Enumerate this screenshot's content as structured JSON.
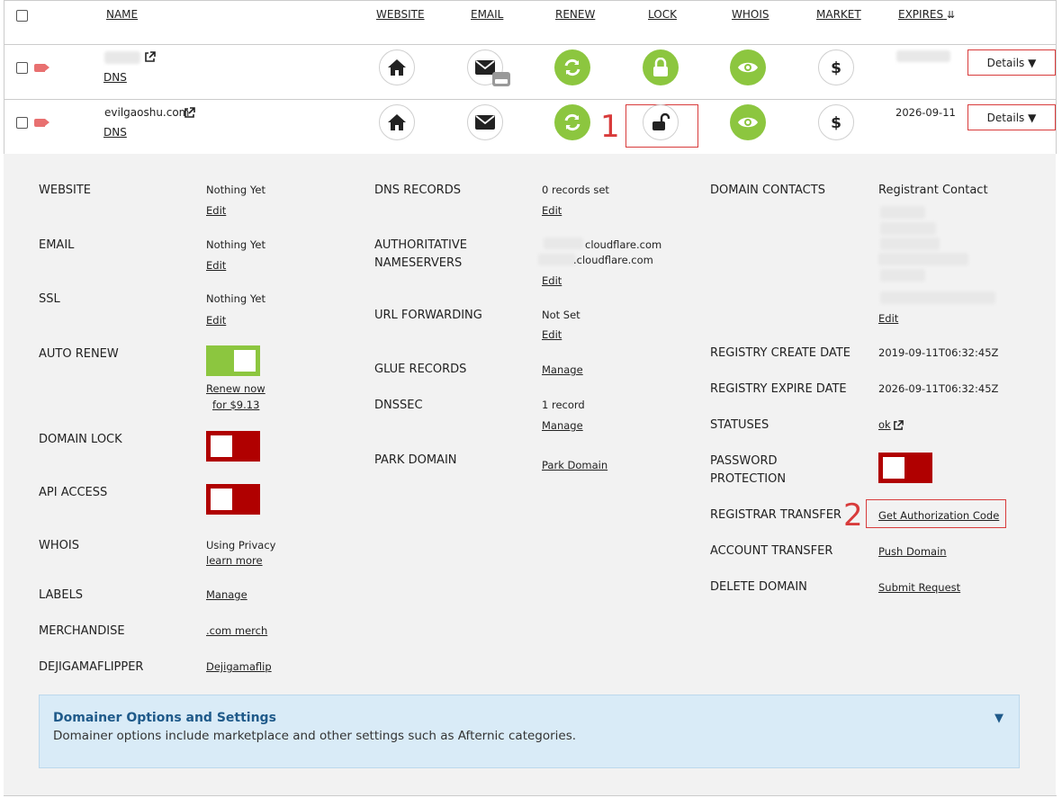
{
  "columns": {
    "name": "NAME",
    "website": "WEBSITE",
    "email": "EMAIL",
    "renew": "RENEW",
    "lock": "LOCK",
    "whois": "WHOIS",
    "market": "MARKET",
    "expires": "EXPIRES"
  },
  "rows": [
    {
      "name": "",
      "dns": "DNS",
      "expires": "",
      "details": "Details ▼"
    },
    {
      "name": "evilgaoshu.com",
      "dns": "DNS",
      "expires": "2026-09-11",
      "details": "Details ▼"
    }
  ],
  "annotations": {
    "one": "1",
    "two": "2"
  },
  "panel": {
    "col1": {
      "website": {
        "label": "WEBSITE",
        "value": "Nothing Yet",
        "link": "Edit"
      },
      "email": {
        "label": "EMAIL",
        "value": "Nothing Yet",
        "link": "Edit"
      },
      "ssl": {
        "label": "SSL",
        "value": "Nothing Yet",
        "link": "Edit"
      },
      "auto_renew": {
        "label": "AUTO RENEW",
        "link1": "Renew now",
        "link2": "for $9.13",
        "state": "on"
      },
      "domain_lock": {
        "label": "DOMAIN LOCK",
        "state": "off"
      },
      "api_access": {
        "label": "API ACCESS",
        "state": "off"
      },
      "whois": {
        "label": "WHOIS",
        "value": "Using Privacy",
        "link": "learn more"
      },
      "labels": {
        "label": "LABELS",
        "link": "Manage"
      },
      "merchandise": {
        "label": "MERCHANDISE",
        "link": ".com merch"
      },
      "dejigama": {
        "label": "DEJIGAMAFLIPPER",
        "link": "Dejigamaflip"
      }
    },
    "col2": {
      "dns_records": {
        "label": "DNS RECORDS",
        "value": "0 records set",
        "link": "Edit"
      },
      "auth_ns": {
        "label1": "AUTHORITATIVE",
        "label2": "NAMESERVERS",
        "ns1": "cloudflare.com",
        "ns2": ".cloudflare.com",
        "link": "Edit"
      },
      "url_forwarding": {
        "label": "URL FORWARDING",
        "value": "Not Set",
        "link": "Edit"
      },
      "glue_records": {
        "label": "GLUE RECORDS",
        "link": "Manage"
      },
      "dnssec": {
        "label": "DNSSEC",
        "value": "1 record",
        "link": "Manage"
      },
      "park_domain": {
        "label": "PARK DOMAIN",
        "link": "Park Domain"
      }
    },
    "col3": {
      "contacts": {
        "label": "DOMAIN CONTACTS",
        "value": "Registrant Contact",
        "link": "Edit"
      },
      "create_date": {
        "label": "REGISTRY CREATE DATE",
        "value": "2019-09-11T06:32:45Z"
      },
      "expire_date": {
        "label": "REGISTRY EXPIRE DATE",
        "value": "2026-09-11T06:32:45Z"
      },
      "statuses": {
        "label": "STATUSES",
        "link": "ok"
      },
      "password": {
        "label1": "PASSWORD",
        "label2": "PROTECTION",
        "state": "off"
      },
      "registrar_transfer": {
        "label": "REGISTRAR TRANSFER",
        "link": "Get Authorization Code"
      },
      "account_transfer": {
        "label": "ACCOUNT TRANSFER",
        "link": "Push Domain"
      },
      "delete_domain": {
        "label": "DELETE DOMAIN",
        "link": "Submit Request"
      }
    }
  },
  "domainer": {
    "title": "Domainer Options and Settings",
    "description": "Domainer options include marketplace and other settings such as Afternic categories.",
    "arrow": "▼"
  },
  "icons": {
    "green": "#8cc63f",
    "red": "#b00000",
    "accent_red": "#d83b3b"
  }
}
